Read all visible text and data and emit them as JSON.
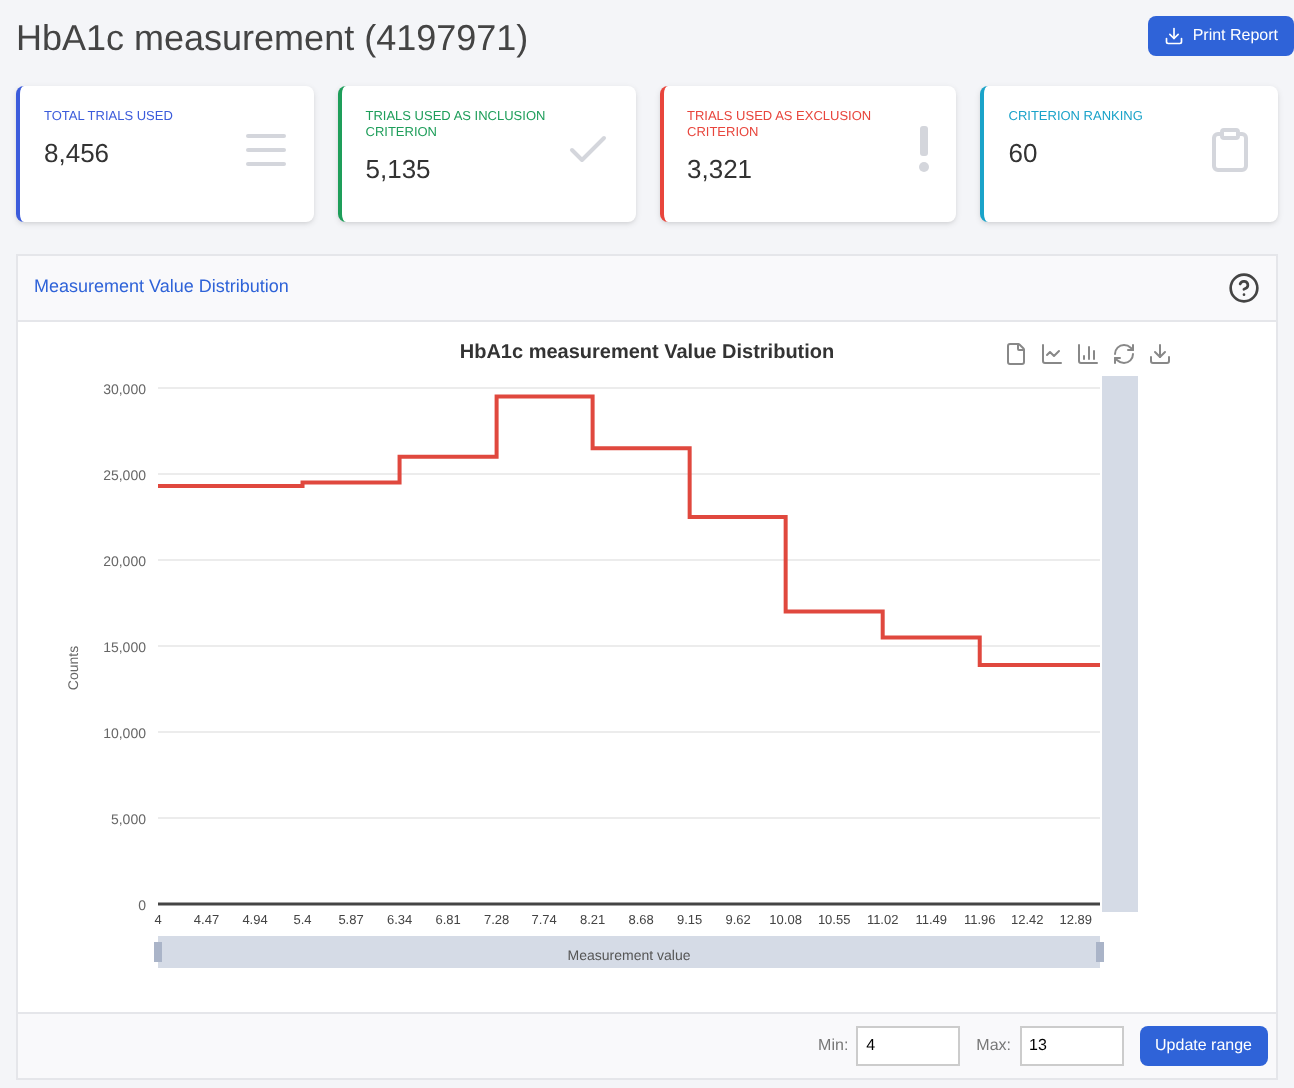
{
  "page": {
    "title": "HbA1c measurement (4197971)",
    "print_button": "Print Report"
  },
  "stats": [
    {
      "kind": "list",
      "label": "TOTAL TRIALS USED",
      "value": "8,456",
      "color": "#3b5bdb"
    },
    {
      "kind": "check",
      "label": "TRIALS USED AS INCLUSION CRITERION",
      "value": "5,135",
      "color": "#1e9e5a"
    },
    {
      "kind": "exclamation",
      "label": "TRIALS USED AS EXCLUSION CRITERION",
      "value": "3,321",
      "color": "#e8453c"
    },
    {
      "kind": "clipboard",
      "label": "CRITERION RANKING",
      "value": "60",
      "color": "#1aa3c9"
    }
  ],
  "panel": {
    "title": "Measurement Value Distribution",
    "chart_data": {
      "type": "line",
      "grid": true,
      "title": "HbA1c measurement Value Distribution",
      "xlabel": "Measurement value",
      "ylabel": "Counts",
      "x": [
        4,
        5.4,
        5.4,
        6.34,
        6.34,
        7.28,
        7.28,
        8.21,
        8.21,
        9.15,
        9.15,
        10.08,
        10.08,
        11.02,
        11.02,
        11.96,
        11.96,
        13.125
      ],
      "series": [
        {
          "color": "#e0483e",
          "values": [
            24300,
            24300,
            24500,
            24500,
            26000,
            26000,
            29500,
            29500,
            26500,
            26500,
            22500,
            22500,
            17000,
            17000,
            15500,
            15500,
            13900,
            13900
          ]
        }
      ],
      "xlim": [
        4,
        13.125
      ],
      "xticks": [
        {
          "value": 4,
          "label": "4"
        },
        {
          "value": 4.47,
          "label": "4.47"
        },
        {
          "value": 4.94,
          "label": "4.94"
        },
        {
          "value": 5.4,
          "label": "5.4"
        },
        {
          "value": 5.87,
          "label": "5.87"
        },
        {
          "value": 6.34,
          "label": "6.34"
        },
        {
          "value": 6.81,
          "label": "6.81"
        },
        {
          "value": 7.28,
          "label": "7.28"
        },
        {
          "value": 7.74,
          "label": "7.74"
        },
        {
          "value": 8.21,
          "label": "8.21"
        },
        {
          "value": 8.68,
          "label": "8.68"
        },
        {
          "value": 9.15,
          "label": "9.15"
        },
        {
          "value": 9.62,
          "label": "9.62"
        },
        {
          "value": 10.08,
          "label": "10.08"
        },
        {
          "value": 10.55,
          "label": "10.55"
        },
        {
          "value": 11.02,
          "label": "11.02"
        },
        {
          "value": 11.49,
          "label": "11.49"
        },
        {
          "value": 11.96,
          "label": "11.96"
        },
        {
          "value": 12.42,
          "label": "12.42"
        },
        {
          "value": 12.89,
          "label": "12.89"
        }
      ],
      "ylim": [
        0,
        30000
      ],
      "yticks": [
        {
          "value": 0,
          "label": "0"
        },
        {
          "value": 5000,
          "label": "5,000"
        },
        {
          "value": 10000,
          "label": "10,000"
        },
        {
          "value": 15000,
          "label": "15,000"
        },
        {
          "value": 20000,
          "label": "20,000"
        },
        {
          "value": 25000,
          "label": "25,000"
        },
        {
          "value": 30000,
          "label": "30,000"
        }
      ]
    },
    "range": {
      "min_label": "Min:",
      "min_value": "4",
      "max_label": "Max:",
      "max_value": "13",
      "button": "Update range"
    }
  }
}
